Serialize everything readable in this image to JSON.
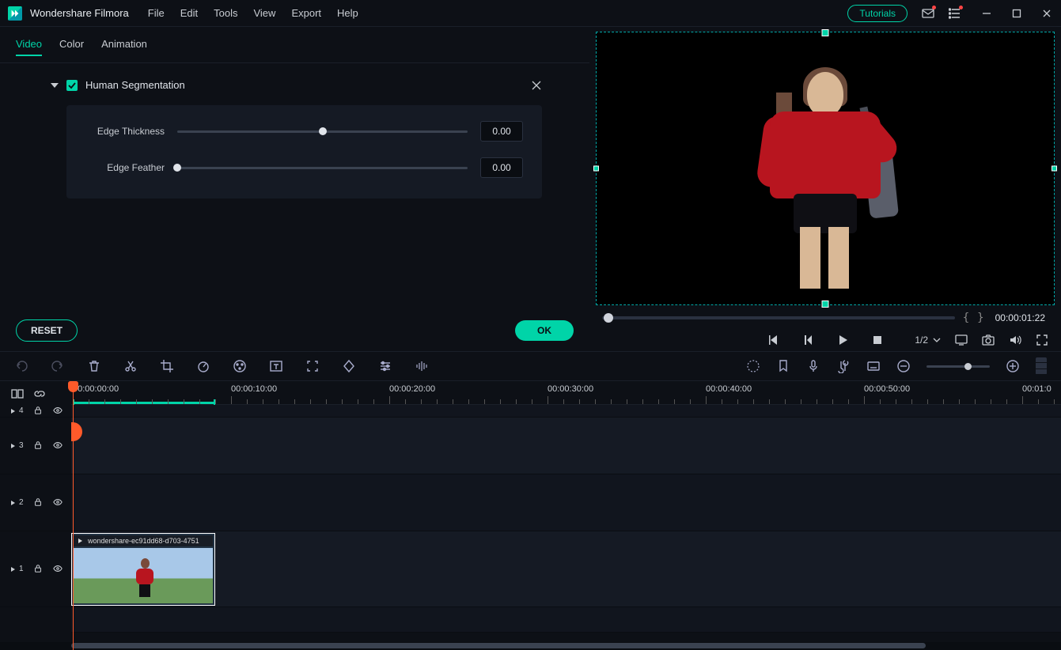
{
  "app_name": "Wondershare Filmora",
  "menu": [
    "File",
    "Edit",
    "Tools",
    "View",
    "Export",
    "Help"
  ],
  "tutorials_label": "Tutorials",
  "tabs": {
    "items": [
      "Video",
      "Color",
      "Animation"
    ],
    "active": 0
  },
  "section": {
    "title": "Human Segmentation",
    "checked": true,
    "sliders": [
      {
        "label": "Edge Thickness",
        "value": "0.00",
        "pos": 50
      },
      {
        "label": "Edge Feather",
        "value": "0.00",
        "pos": 0
      }
    ]
  },
  "buttons": {
    "reset": "RESET",
    "ok": "OK"
  },
  "preview": {
    "timecode": "00:00:01:22",
    "ratio": "1/2"
  },
  "timeline": {
    "labels": [
      "00:00:00:00",
      "00:00:10:00",
      "00:00:20:00",
      "00:00:30:00",
      "00:00:40:00",
      "00:00:50:00",
      "00:01:0"
    ],
    "tracks": [
      "4",
      "3",
      "2",
      "1"
    ],
    "media_track_prefix": "",
    "clip_name": "wondershare-ec91dd68-d703-4751"
  }
}
